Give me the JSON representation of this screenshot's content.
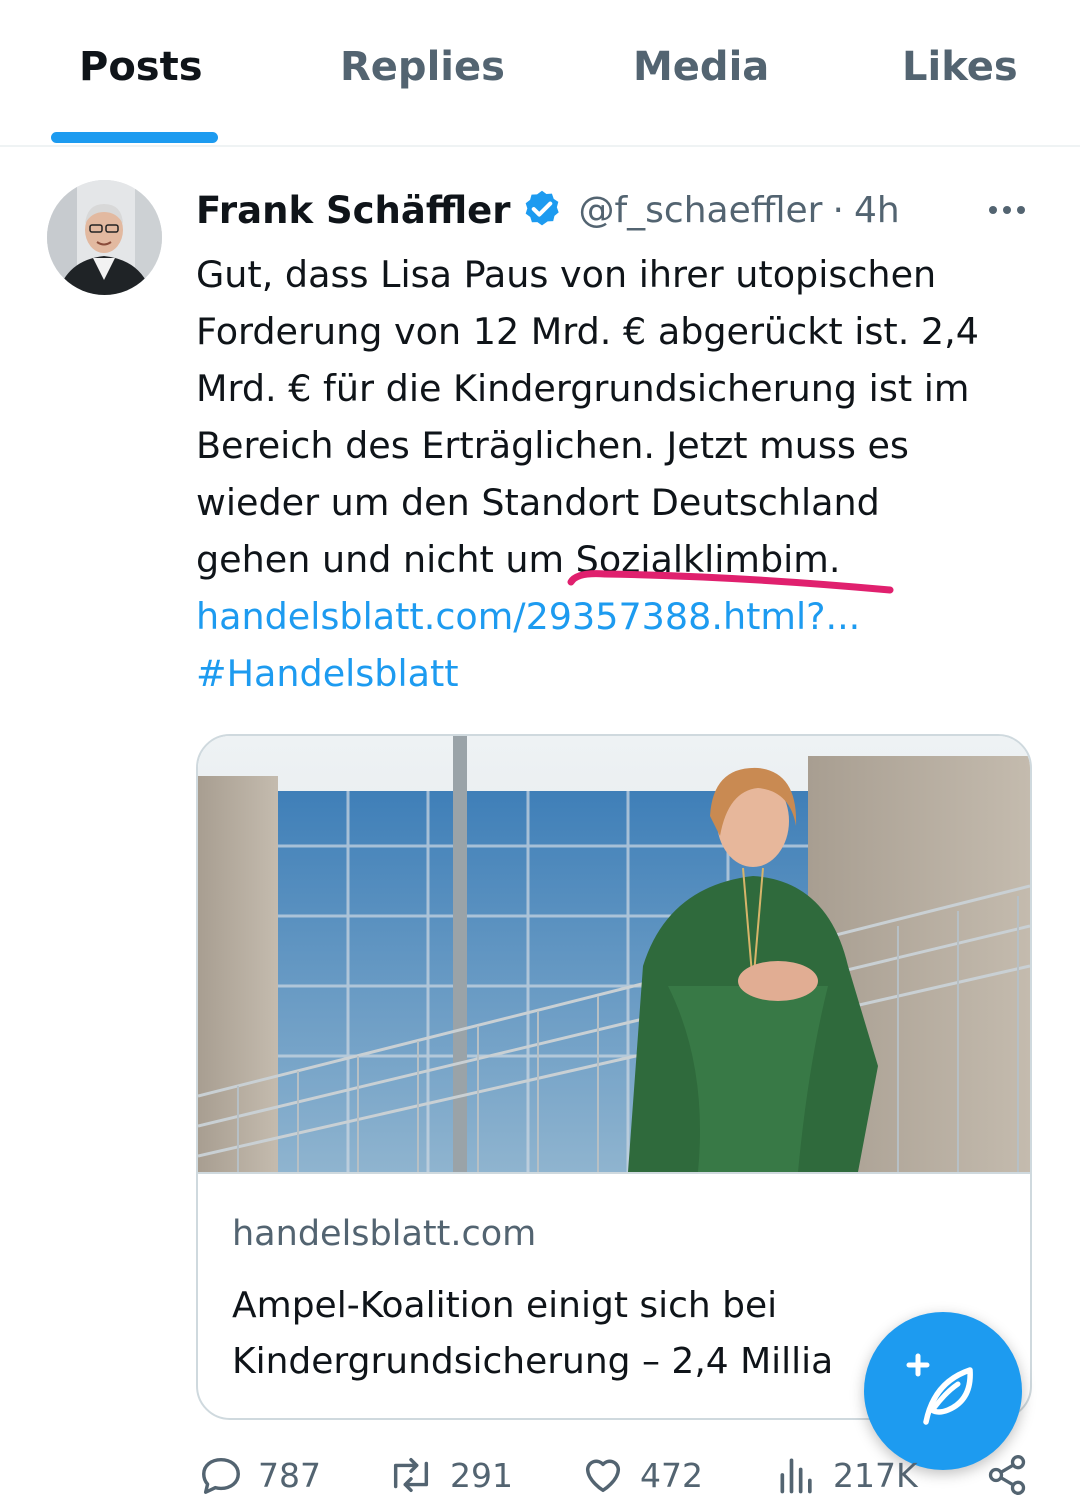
{
  "tabs": [
    {
      "label": "Posts",
      "active": true
    },
    {
      "label": "Replies",
      "active": false
    },
    {
      "label": "Media",
      "active": false
    },
    {
      "label": "Likes",
      "active": false
    }
  ],
  "tweet": {
    "author_name": "Frank Schäffler",
    "handle": "@f_schaeffler",
    "separator": "·",
    "time": "4h",
    "text_lines": [
      "Gut, dass Lisa Paus von ihrer utopischen",
      "Forderung von 12 Mrd. € abgerückt ist. 2,4",
      "Mrd. € für die Kindergrundsicherung ist im",
      "Bereich des Erträglichen. Jetzt muss es",
      "wieder um den Standort Deutschland",
      "gehen und nicht um Sozialklimbim."
    ],
    "link": "handelsblatt.com/29357388.html?...",
    "hashtag": "#Handelsblatt"
  },
  "card": {
    "domain": "handelsblatt.com",
    "title_lines": [
      "Ampel-Koalition einigt sich bei",
      "Kindergrundsicherung – 2,4 Millia"
    ]
  },
  "actions": {
    "replies": "787",
    "retweets": "291",
    "likes": "472",
    "views": "217K"
  },
  "icons": [
    "verified-badge-icon",
    "more-icon",
    "compose-icon",
    "reply-icon",
    "retweet-icon",
    "like-icon",
    "views-icon",
    "share-icon"
  ],
  "colors": {
    "accent": "#1d9bf0",
    "text": "#0f1419",
    "secondary_text": "#536471",
    "border": "#cfd9de",
    "annotation": "#e0206e"
  }
}
